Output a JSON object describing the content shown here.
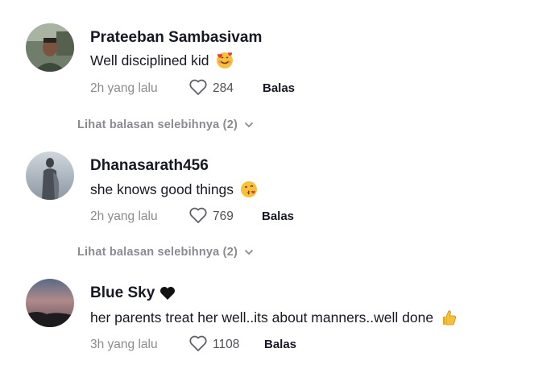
{
  "comments": [
    {
      "username": "Prateeban Sambasivam",
      "text": "Well disciplined kid",
      "emoji_icon": "smiling-face-with-hearts-icon",
      "time": "2h yang lalu",
      "likes": "284",
      "reply_label": "Balas",
      "more_replies": "Lihat balasan selebihnya (2)"
    },
    {
      "username": "Dhanasarath456",
      "text": "she knows good things",
      "emoji_icon": "face-blowing-kiss-icon",
      "time": "2h yang lalu",
      "likes": "769",
      "reply_label": "Balas",
      "more_replies": "Lihat balasan selebihnya (2)"
    },
    {
      "username": "Blue Sky",
      "username_icon": "black-heart-icon",
      "text": "her parents treat her well..its about manners..well done",
      "emoji_icon": "thumbs-up-icon",
      "time": "3h yang lalu",
      "likes": "1108",
      "reply_label": "Balas"
    }
  ]
}
